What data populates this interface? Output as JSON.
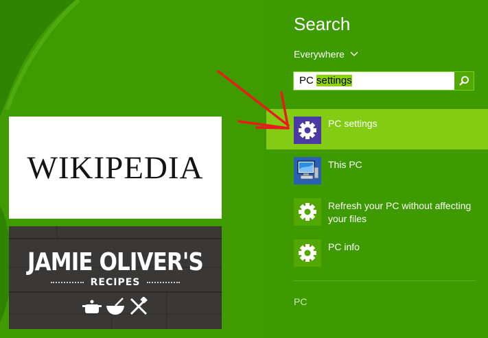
{
  "start_screen": {
    "tiles": [
      {
        "app": "Wikipedia",
        "wordmark": "WIKIPEDIA"
      },
      {
        "app": "Jamie Oliver's Recipes",
        "title": "JAMIE OLIVER'S",
        "subtitle": "RECIPES"
      }
    ]
  },
  "search_charm": {
    "title": "Search",
    "scope": {
      "label": "Everywhere"
    },
    "query": {
      "typed": "PC ",
      "highlighted": "settings"
    },
    "results": [
      {
        "label": "PC settings",
        "icon": "gear-icon",
        "selected": true
      },
      {
        "label": "This PC",
        "icon": "computer-icon",
        "selected": false
      },
      {
        "label_line1": "Refresh your PC without affecting",
        "label_line2": "your files",
        "icon": "gear-icon",
        "selected": false
      },
      {
        "label": "PC info",
        "icon": "gear-icon",
        "selected": false
      }
    ],
    "section_label": "PC"
  },
  "colors": {
    "background": "#3d9a00",
    "selected_result": "#84cc14",
    "highlight": "#8dd40a",
    "gear_tile": "#52a800",
    "selected_gear_tile": "#4b3aa6",
    "annotation_arrow": "#e81c1c"
  }
}
